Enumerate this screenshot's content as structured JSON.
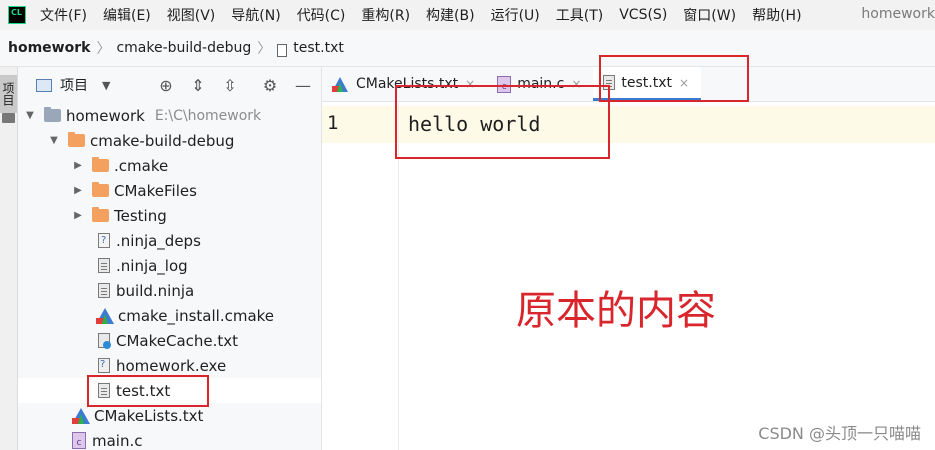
{
  "menubar": {
    "logo_text": "CL",
    "items": [
      "文件(F)",
      "编辑(E)",
      "视图(V)",
      "导航(N)",
      "代码(C)",
      "重构(R)",
      "构建(B)",
      "运行(U)",
      "工具(T)",
      "VCS(S)",
      "窗口(W)",
      "帮助(H)"
    ],
    "window_project": "homework"
  },
  "breadcrumb": {
    "items": [
      "homework",
      "cmake-build-debug",
      "test.txt"
    ]
  },
  "tool_stripe": {
    "project_tab": "项目"
  },
  "project_panel": {
    "title": "项目",
    "dropdown": "▼",
    "icons": [
      "locate-icon",
      "expand-all-icon",
      "collapse-all-icon",
      "gear-icon",
      "minimize-icon"
    ],
    "tree": [
      {
        "label": "homework",
        "path": "E:\\C\\homework",
        "type": "root-folder"
      },
      {
        "label": "cmake-build-debug",
        "type": "folder"
      },
      {
        "label": ".cmake",
        "type": "folder"
      },
      {
        "label": "CMakeFiles",
        "type": "folder"
      },
      {
        "label": "Testing",
        "type": "folder"
      },
      {
        "label": ".ninja_deps",
        "type": "unknown-file"
      },
      {
        "label": ".ninja_log",
        "type": "text-file"
      },
      {
        "label": "build.ninja",
        "type": "text-file"
      },
      {
        "label": "cmake_install.cmake",
        "type": "cmake-file"
      },
      {
        "label": "CMakeCache.txt",
        "type": "cache-file"
      },
      {
        "label": "homework.exe",
        "type": "exe-file"
      },
      {
        "label": "test.txt",
        "type": "text-file"
      },
      {
        "label": "CMakeLists.txt",
        "type": "cmake-file"
      },
      {
        "label": "main.c",
        "type": "c-file"
      }
    ]
  },
  "editor_tabs": [
    {
      "label": "CMakeLists.txt",
      "close": "×"
    },
    {
      "label": "main.c",
      "close": "×"
    },
    {
      "label": "test.txt",
      "close": "×",
      "active": true
    }
  ],
  "editor": {
    "line_number": "1",
    "code": "hello world",
    "annotation": "原本的内容"
  },
  "watermark": "CSDN @头顶一只喵喵",
  "colors": {
    "highlight_red": "#d8262c",
    "accent_blue": "#3d7ad1",
    "folder_orange": "#f4a160"
  }
}
